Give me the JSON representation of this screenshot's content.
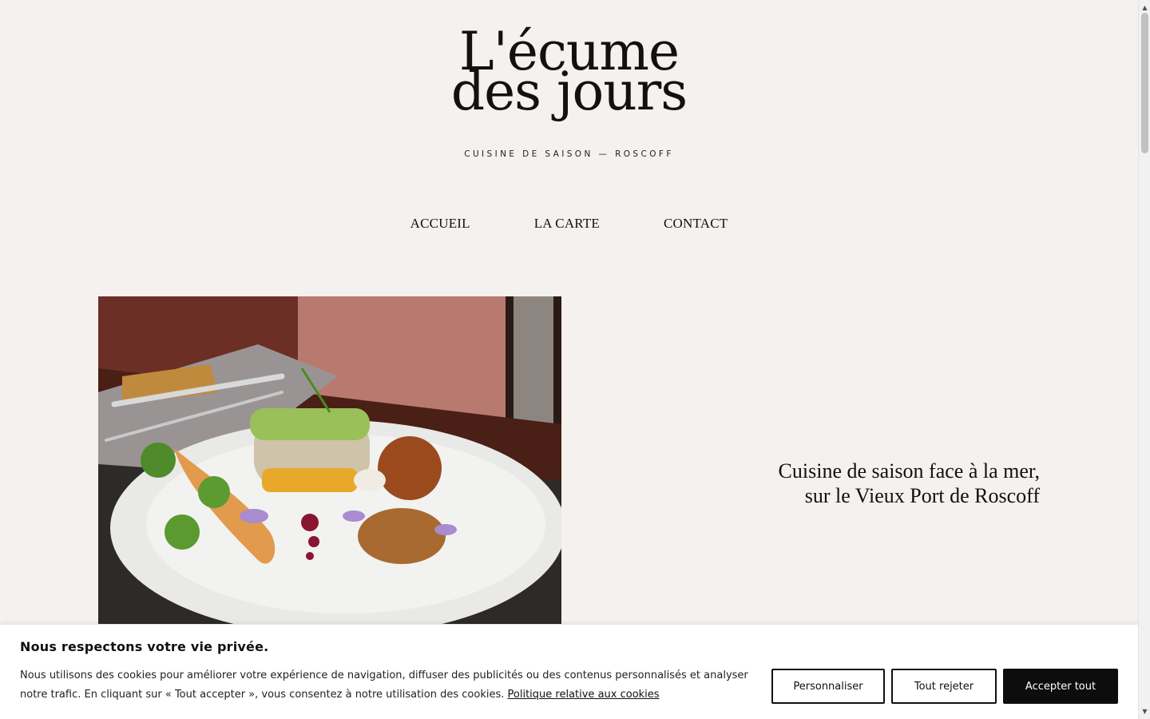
{
  "brand": {
    "logo_line1": "L'écume",
    "logo_line2": "des jours",
    "tagline": "CUISINE DE SAISON — ROSCOFF"
  },
  "nav": {
    "items": [
      {
        "label": "ACCUEIL"
      },
      {
        "label": "LA CARTE"
      },
      {
        "label": "CONTACT"
      }
    ]
  },
  "hero": {
    "text_line1": "Cuisine de saison face à la mer,",
    "text_line2": "sur le Vieux Port de Roscoff",
    "image_icon": "plated-dish-photo"
  },
  "cookie": {
    "title": "Nous respectons votre vie privée.",
    "body": "Nous utilisons des cookies pour améliorer votre expérience de navigation, diffuser des publicités ou des contenus personnalisés et analyser notre trafic. En cliquant sur « Tout accepter », vous consentez à notre utilisation des cookies.",
    "policy_link": "Politique relative aux cookies",
    "customize_label": "Personnaliser",
    "reject_label": "Tout rejeter",
    "accept_label": "Accepter tout"
  },
  "colors": {
    "background": "#f5f1ee",
    "text": "#111111",
    "accept_button": "#0d0d0d"
  }
}
